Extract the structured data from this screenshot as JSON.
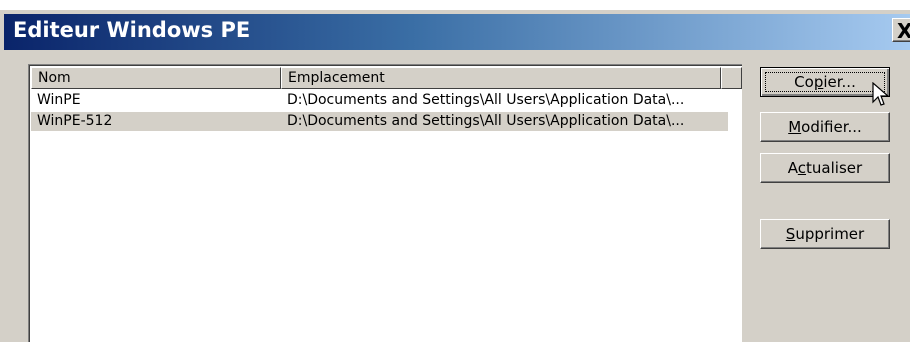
{
  "window": {
    "title": "Editeur Windows PE",
    "close_label": "X"
  },
  "list": {
    "columns": [
      "Nom",
      "Emplacement"
    ],
    "rows": [
      {
        "nom": "WinPE",
        "emplacement": "D:\\Documents and Settings\\All Users\\Application Data\\..."
      },
      {
        "nom": "WinPE-512",
        "emplacement": "D:\\Documents and Settings\\All Users\\Application Data\\..."
      }
    ],
    "selected_row": 1
  },
  "buttons": {
    "copier": {
      "pre": "Co",
      "mnemonic": "p",
      "post": "ier..."
    },
    "modifier": {
      "pre": "",
      "mnemonic": "M",
      "post": "odifier..."
    },
    "actualiser": {
      "pre": "A",
      "mnemonic": "c",
      "post": "tualiser"
    },
    "supprimer": {
      "pre": "",
      "mnemonic": "S",
      "post": "upprimer"
    }
  },
  "colors": {
    "title_start": "#0a246a",
    "title_end": "#a6caf0",
    "face": "#d4d0c8"
  },
  "icons": {
    "cursor": "mouse-pointer-icon"
  }
}
